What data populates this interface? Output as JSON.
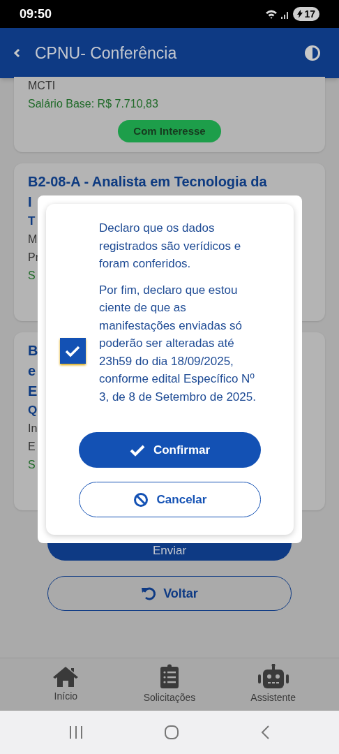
{
  "status_bar": {
    "time": "09:50",
    "battery": "17"
  },
  "header": {
    "title": "CPNU- Conferência"
  },
  "cards": [
    {
      "lines": [
        {
          "kind": "text",
          "text": "MCTI"
        },
        {
          "kind": "salary",
          "text": "Salário Base: R$ 7.710,83"
        }
      ],
      "badge": "Com Interesse"
    },
    {
      "lines": [
        {
          "kind": "title",
          "text": "B2-08-A - Analista em Tecnologia da"
        },
        {
          "kind": "title",
          "text": "I"
        },
        {
          "kind": "subtitle",
          "text": "T"
        },
        {
          "kind": "text",
          "text": "M"
        },
        {
          "kind": "text",
          "text": "Pr"
        },
        {
          "kind": "salary",
          "text": "S"
        }
      ]
    },
    {
      "lines": [
        {
          "kind": "title",
          "text": "B"
        },
        {
          "kind": "title",
          "text": "e"
        },
        {
          "kind": "title",
          "text": "E"
        },
        {
          "kind": "subtitle",
          "text": "Q"
        },
        {
          "kind": "text",
          "text": "In"
        },
        {
          "kind": "text",
          "text": "E"
        },
        {
          "kind": "salary",
          "text": "S"
        }
      ]
    }
  ],
  "send_button": {
    "label": "Enviar"
  },
  "back_button": {
    "label": "Voltar"
  },
  "dialog": {
    "paragraphs": [
      "Declaro que os dados registrados são verídicos e foram conferidos.",
      "Por fim, declaro que estou ciente de que as manifestações enviadas só poderão ser alteradas até 23h59 do dia 18/09/2025, conforme edital Específico Nº 3, de 8 de Setembro de 2025."
    ],
    "checked": true,
    "confirm": "Confirmar",
    "cancel": "Cancelar"
  },
  "bottom_nav": [
    {
      "kind": "home",
      "label": "Início"
    },
    {
      "kind": "requests",
      "label": "Solicitações"
    },
    {
      "kind": "assistant",
      "label": "Assistente"
    }
  ]
}
